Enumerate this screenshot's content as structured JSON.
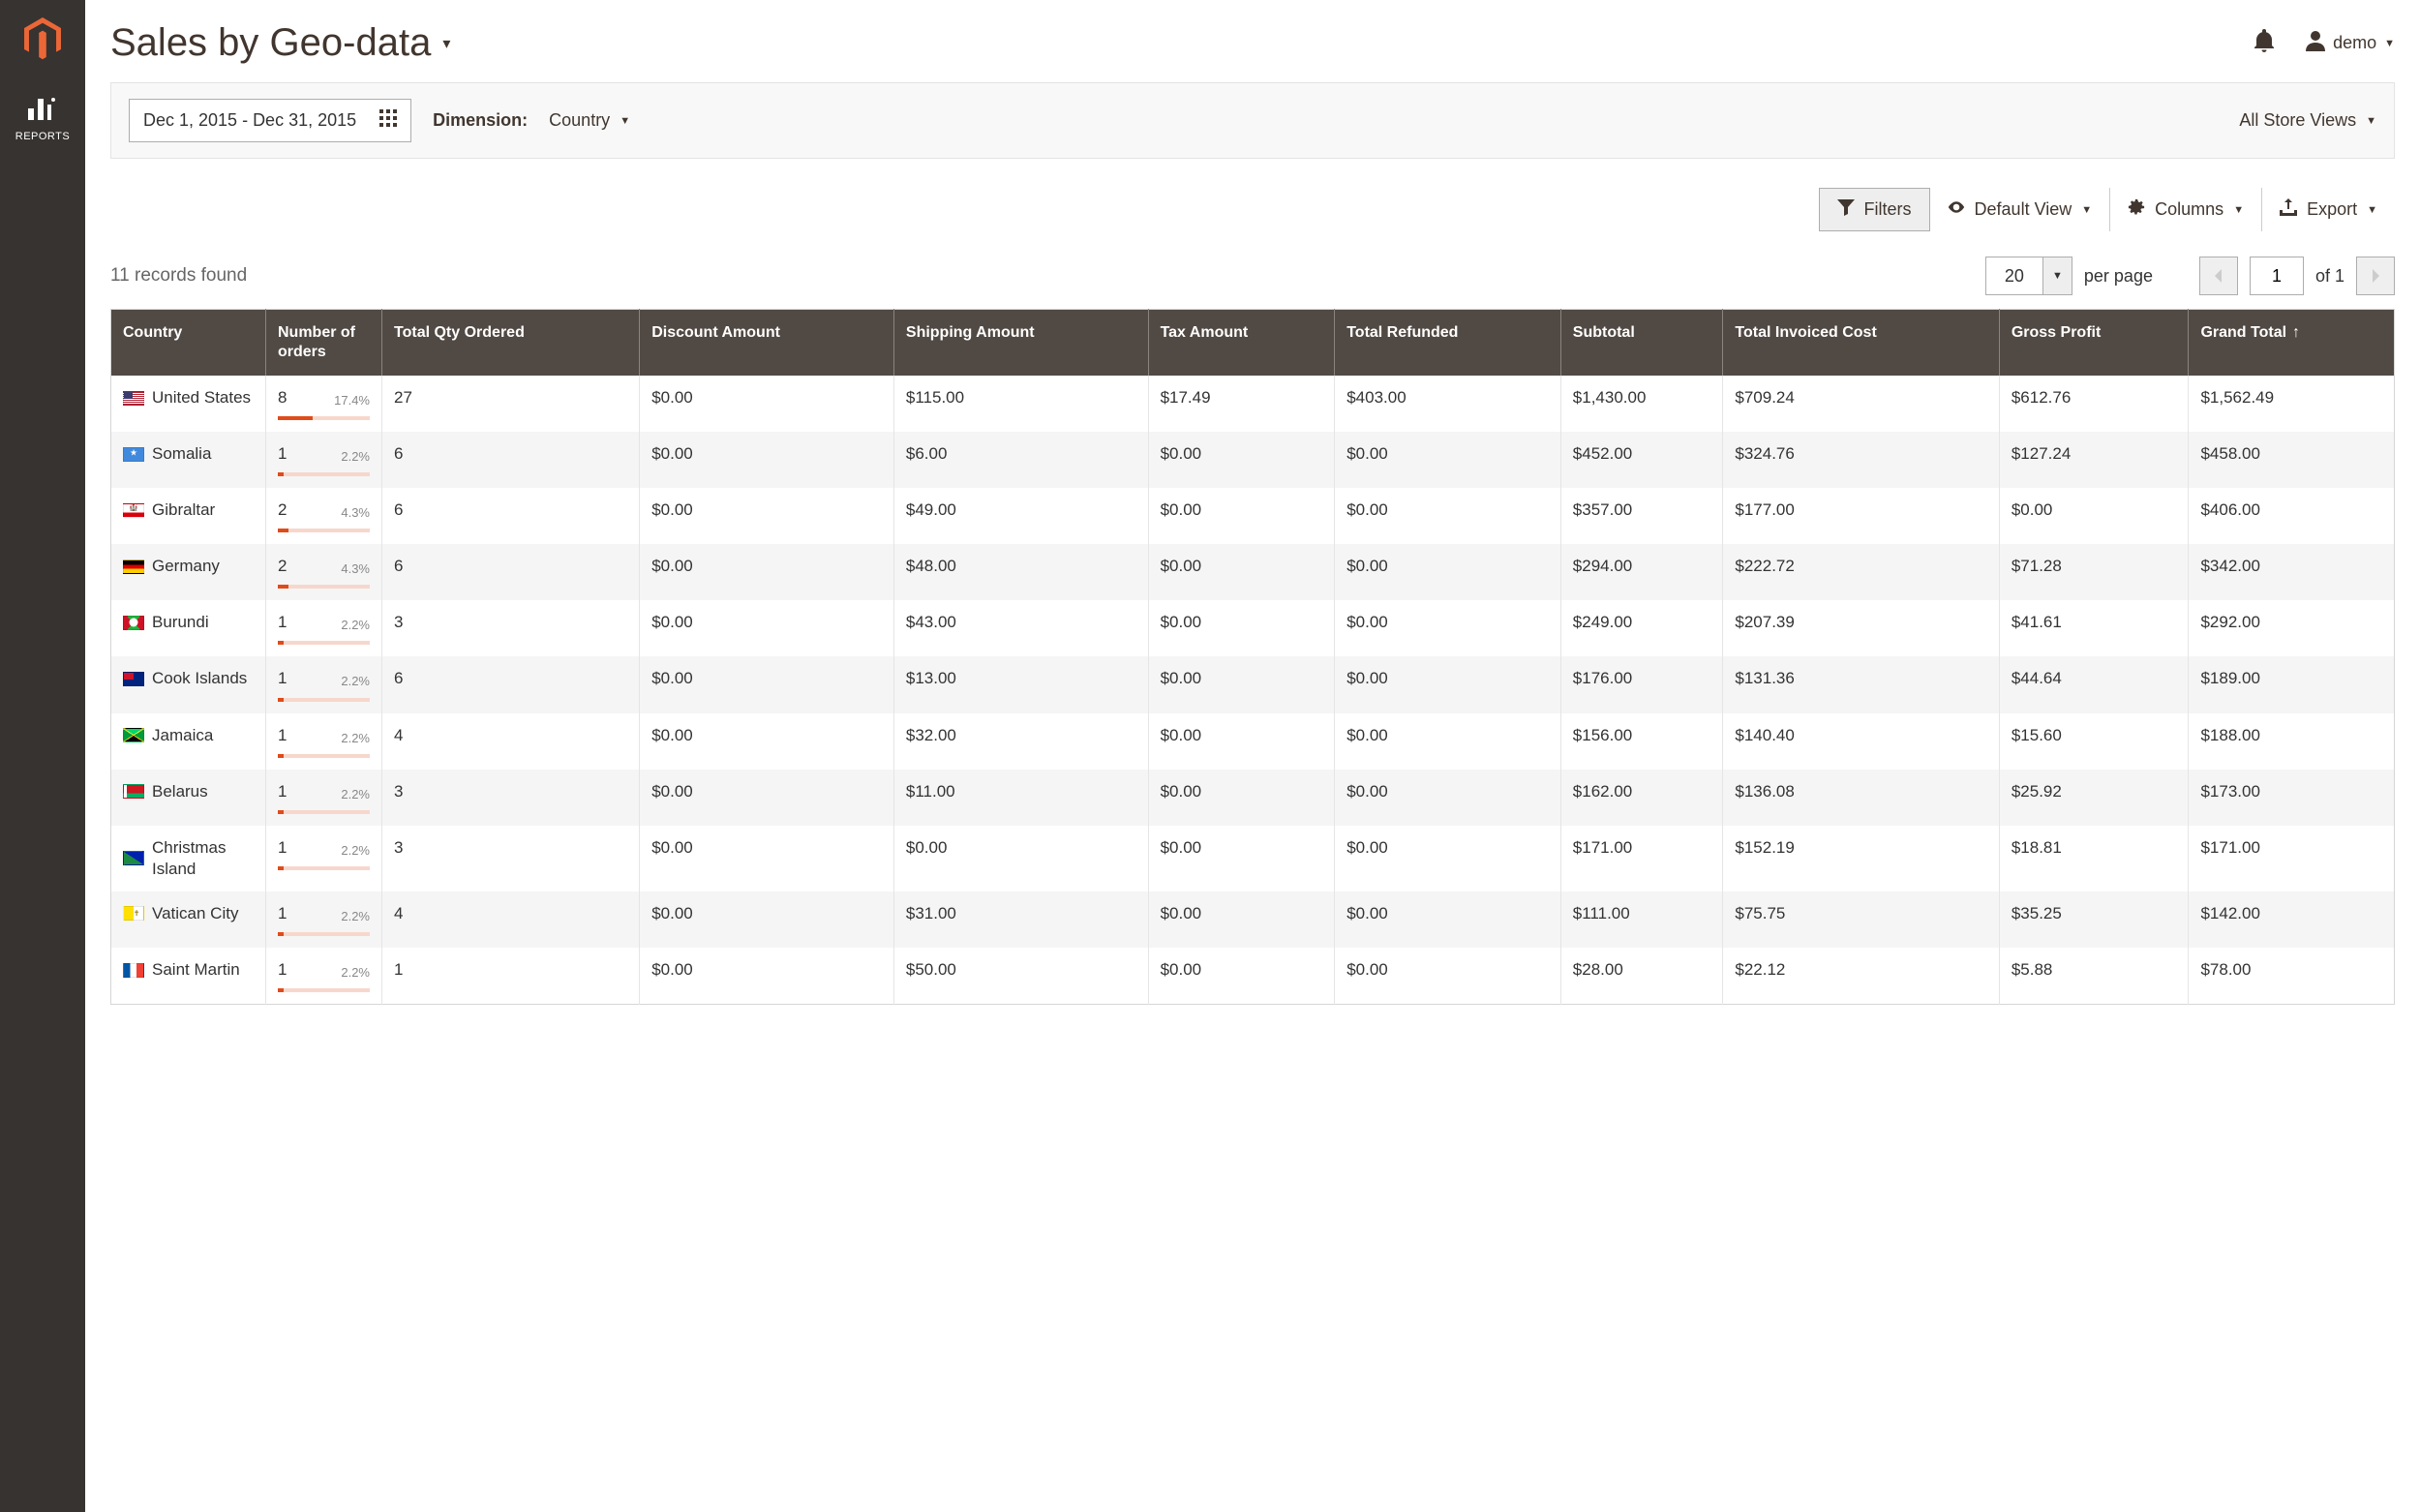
{
  "sidebar": {
    "reports_label": "REPORTS"
  },
  "header": {
    "title": "Sales by Geo-data",
    "user": "demo"
  },
  "controls": {
    "date_range": "Dec 1, 2015 - Dec 31, 2015",
    "dimension_label": "Dimension:",
    "dimension_value": "Country",
    "store_scope": "All Store Views"
  },
  "toolbar": {
    "filters": "Filters",
    "default_view": "Default View",
    "columns": "Columns",
    "export": "Export"
  },
  "listing": {
    "records_found": "11 records found",
    "page_size": "20",
    "per_page_label": "per page",
    "current_page": "1",
    "total_pages_label": "of 1"
  },
  "columns": {
    "country": "Country",
    "orders": "Number of orders",
    "qty": "Total Qty Ordered",
    "discount": "Discount Amount",
    "shipping": "Shipping Amount",
    "tax": "Tax Amount",
    "refunded": "Total Refunded",
    "subtotal": "Subtotal",
    "invoiced": "Total Invoiced Cost",
    "profit": "Gross Profit",
    "grand": "Grand Total"
  },
  "rows": [
    {
      "flag": "flag-us",
      "country": "United States",
      "orders": "8",
      "orders_pct": "17.4%",
      "orders_bar": 38,
      "qty": "27",
      "discount": "$0.00",
      "shipping": "$115.00",
      "tax": "$17.49",
      "refunded": "$403.00",
      "subtotal": "$1,430.00",
      "invoiced": "$709.24",
      "profit": "$612.76",
      "grand": "$1,562.49"
    },
    {
      "flag": "flag-so",
      "country": "Somalia",
      "orders": "1",
      "orders_pct": "2.2%",
      "orders_bar": 6,
      "qty": "6",
      "discount": "$0.00",
      "shipping": "$6.00",
      "tax": "$0.00",
      "refunded": "$0.00",
      "subtotal": "$452.00",
      "invoiced": "$324.76",
      "profit": "$127.24",
      "grand": "$458.00"
    },
    {
      "flag": "flag-gi",
      "country": "Gibraltar",
      "orders": "2",
      "orders_pct": "4.3%",
      "orders_bar": 12,
      "qty": "6",
      "discount": "$0.00",
      "shipping": "$49.00",
      "tax": "$0.00",
      "refunded": "$0.00",
      "subtotal": "$357.00",
      "invoiced": "$177.00",
      "profit": "$0.00",
      "grand": "$406.00"
    },
    {
      "flag": "flag-de",
      "country": "Germany",
      "orders": "2",
      "orders_pct": "4.3%",
      "orders_bar": 12,
      "qty": "6",
      "discount": "$0.00",
      "shipping": "$48.00",
      "tax": "$0.00",
      "refunded": "$0.00",
      "subtotal": "$294.00",
      "invoiced": "$222.72",
      "profit": "$71.28",
      "grand": "$342.00"
    },
    {
      "flag": "flag-bi",
      "country": "Burundi",
      "orders": "1",
      "orders_pct": "2.2%",
      "orders_bar": 6,
      "qty": "3",
      "discount": "$0.00",
      "shipping": "$43.00",
      "tax": "$0.00",
      "refunded": "$0.00",
      "subtotal": "$249.00",
      "invoiced": "$207.39",
      "profit": "$41.61",
      "grand": "$292.00"
    },
    {
      "flag": "flag-ck",
      "country": "Cook Islands",
      "orders": "1",
      "orders_pct": "2.2%",
      "orders_bar": 6,
      "qty": "6",
      "discount": "$0.00",
      "shipping": "$13.00",
      "tax": "$0.00",
      "refunded": "$0.00",
      "subtotal": "$176.00",
      "invoiced": "$131.36",
      "profit": "$44.64",
      "grand": "$189.00"
    },
    {
      "flag": "flag-jm",
      "country": "Jamaica",
      "orders": "1",
      "orders_pct": "2.2%",
      "orders_bar": 6,
      "qty": "4",
      "discount": "$0.00",
      "shipping": "$32.00",
      "tax": "$0.00",
      "refunded": "$0.00",
      "subtotal": "$156.00",
      "invoiced": "$140.40",
      "profit": "$15.60",
      "grand": "$188.00"
    },
    {
      "flag": "flag-by",
      "country": "Belarus",
      "orders": "1",
      "orders_pct": "2.2%",
      "orders_bar": 6,
      "qty": "3",
      "discount": "$0.00",
      "shipping": "$11.00",
      "tax": "$0.00",
      "refunded": "$0.00",
      "subtotal": "$162.00",
      "invoiced": "$136.08",
      "profit": "$25.92",
      "grand": "$173.00"
    },
    {
      "flag": "flag-cx",
      "country": "Christmas Island",
      "orders": "1",
      "orders_pct": "2.2%",
      "orders_bar": 6,
      "qty": "3",
      "discount": "$0.00",
      "shipping": "$0.00",
      "tax": "$0.00",
      "refunded": "$0.00",
      "subtotal": "$171.00",
      "invoiced": "$152.19",
      "profit": "$18.81",
      "grand": "$171.00"
    },
    {
      "flag": "flag-va",
      "country": "Vatican City",
      "orders": "1",
      "orders_pct": "2.2%",
      "orders_bar": 6,
      "qty": "4",
      "discount": "$0.00",
      "shipping": "$31.00",
      "tax": "$0.00",
      "refunded": "$0.00",
      "subtotal": "$111.00",
      "invoiced": "$75.75",
      "profit": "$35.25",
      "grand": "$142.00"
    },
    {
      "flag": "flag-mf",
      "country": "Saint Martin",
      "orders": "1",
      "orders_pct": "2.2%",
      "orders_bar": 6,
      "qty": "1",
      "discount": "$0.00",
      "shipping": "$50.00",
      "tax": "$0.00",
      "refunded": "$0.00",
      "subtotal": "$28.00",
      "invoiced": "$22.12",
      "profit": "$5.88",
      "grand": "$78.00"
    }
  ]
}
